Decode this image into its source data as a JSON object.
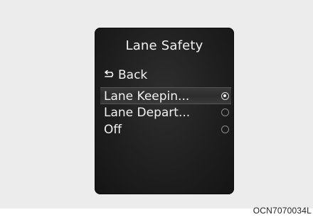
{
  "panel": {
    "title": "Lane Safety",
    "back_label": "Back",
    "back_icon": "return-arrow-icon"
  },
  "menu": {
    "items": [
      {
        "label": "Lane Keepin...",
        "selected": true
      },
      {
        "label": "Lane Depart...",
        "selected": false
      },
      {
        "label": "Off",
        "selected": false
      }
    ]
  },
  "figure_code": "OCN7070034L"
}
